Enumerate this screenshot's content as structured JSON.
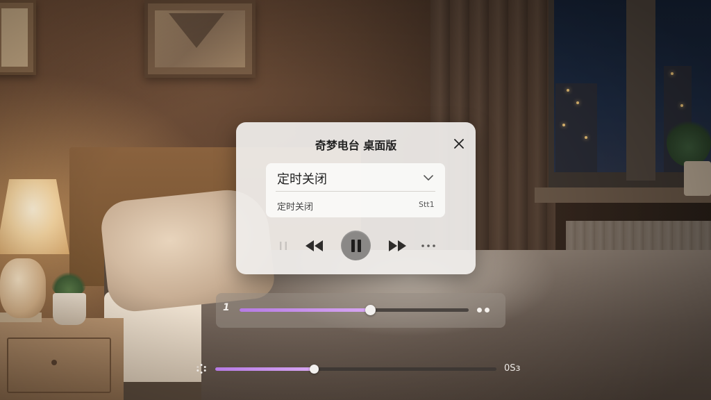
{
  "window": {
    "title": "奇梦电台 桌面版",
    "close_icon": "close-icon"
  },
  "timer_dropdown": {
    "selected": "定时关闭",
    "chevron_icon": "chevron-down-icon",
    "option": {
      "label": "定时关闭",
      "shortcut": "Stt1"
    }
  },
  "controls": {
    "stop_icon": "stop-icon",
    "previous_icon": "rewind-icon",
    "play_pause_icon": "pause-icon",
    "next_icon": "fast-forward-icon",
    "more_icon": "more-icon"
  },
  "progress_bar_primary": {
    "lead_label": "1",
    "progress": 0.57,
    "fill_color": "#c28ae8",
    "trailing_icon": "more-dots-icon"
  },
  "progress_bar_secondary": {
    "leading_icon": "loading-icon",
    "progress": 0.35,
    "fill_color": "#c28ae8",
    "time_label": "0Sз"
  }
}
